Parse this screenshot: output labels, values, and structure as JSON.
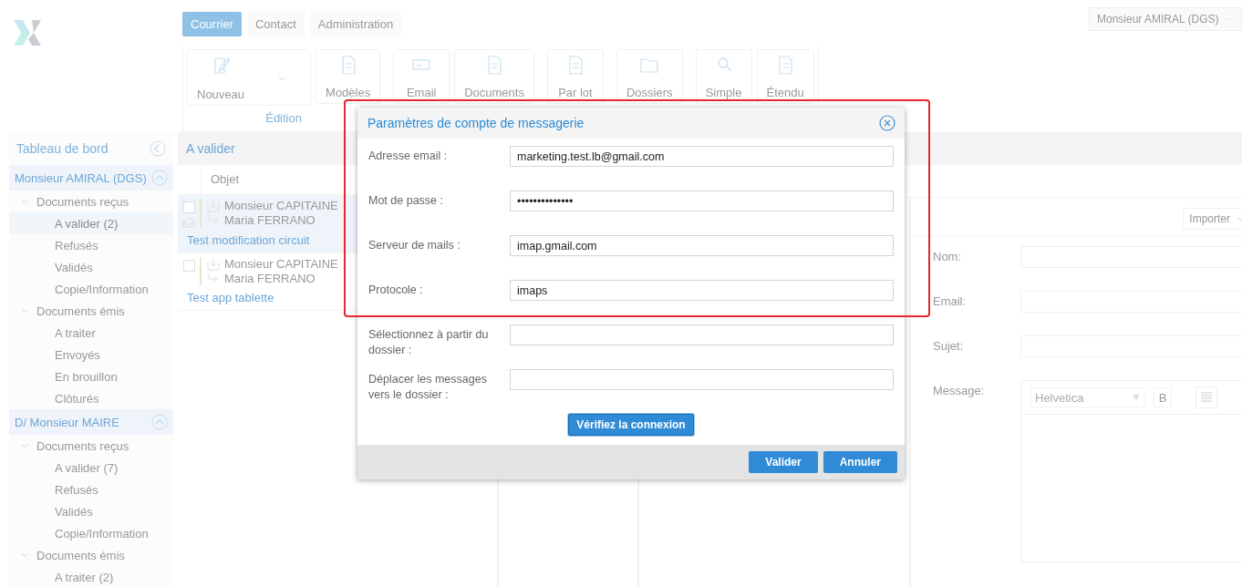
{
  "top_bar": {
    "tabs": [
      {
        "label": "Courrier",
        "selected": true
      },
      {
        "label": "Contact",
        "selected": false
      },
      {
        "label": "Administration",
        "selected": false
      }
    ],
    "user_select": "Monsieur AMIRAL (DGS)"
  },
  "ribbon": {
    "groups": [
      {
        "label": "Édition",
        "buttons": [
          {
            "label": "Nouveau",
            "kind": "split"
          },
          {
            "label": "Modèles",
            "kind": "plain"
          }
        ]
      },
      {
        "buttons": [
          {
            "label": "Email",
            "kind": "plain"
          },
          {
            "label": "Documents",
            "kind": "plain"
          }
        ]
      },
      {
        "buttons": [
          {
            "label": "Par lot",
            "kind": "plain"
          }
        ]
      },
      {
        "buttons": [
          {
            "label": "Dossiers",
            "kind": "plain"
          }
        ]
      },
      {
        "buttons": [
          {
            "label": "Simple",
            "kind": "plain"
          },
          {
            "label": "Étendu",
            "kind": "plain"
          }
        ]
      }
    ]
  },
  "sidebar": {
    "title": "Tableau de bord",
    "sections": [
      {
        "label": "Monsieur AMIRAL (DGS)",
        "expanded": true,
        "children": [
          {
            "label": "Documents reçus",
            "expanded": true,
            "children": [
              {
                "label": "A valider (2)",
                "selected": true
              },
              {
                "label": "Refusés",
                "selected": false
              },
              {
                "label": "Validés",
                "selected": false
              },
              {
                "label": "Copie/Information",
                "selected": false
              }
            ]
          },
          {
            "label": "Documents émis",
            "expanded": true,
            "children": [
              {
                "label": "A traiter",
                "selected": false
              },
              {
                "label": "Envoyés",
                "selected": false
              },
              {
                "label": "En brouillon",
                "selected": false
              },
              {
                "label": "Clôturés",
                "selected": false
              }
            ]
          }
        ]
      },
      {
        "label": "D/ Monsieur MAIRE",
        "expanded": true,
        "children": [
          {
            "label": "Documents reçus",
            "expanded": true,
            "children": [
              {
                "label": "A valider (7)",
                "selected": false
              },
              {
                "label": "Refusés",
                "selected": false
              },
              {
                "label": "Validés",
                "selected": false
              },
              {
                "label": "Copie/Information",
                "selected": false
              }
            ]
          },
          {
            "label": "Documents émis",
            "expanded": true,
            "children": [
              {
                "label": "A traiter (2)",
                "selected": false
              }
            ]
          }
        ]
      }
    ]
  },
  "list": {
    "title": "A valider",
    "column": "Objet",
    "rows": [
      {
        "checked": false,
        "opened": true,
        "from": "Monsieur CAPITAINE",
        "to": "Maria FERRANO",
        "subject": "Test modification circuit",
        "selected": true
      },
      {
        "checked": false,
        "opened": false,
        "from": "Monsieur CAPITAINE",
        "to": "Maria FERRANO",
        "subject": "Test app tablette",
        "selected": false
      }
    ]
  },
  "compose": {
    "import_button": "Importer",
    "fields": [
      {
        "label": "Nom:",
        "kind": "line"
      },
      {
        "label": "Email:",
        "kind": "line"
      },
      {
        "label": "Sujet:",
        "kind": "line"
      },
      {
        "label": "Message:",
        "kind": "editor"
      }
    ],
    "editor": {
      "font": "Helvetica",
      "bold_button": "B"
    }
  },
  "dialog": {
    "title": "Paramètres de compte de messagerie",
    "fields": [
      {
        "label": "Adresse email :",
        "value": "marketing.test.lb@gmail.com"
      },
      {
        "label": "Mot de passe :",
        "value": "••••••••••••••"
      },
      {
        "label": "Serveur de mails :",
        "value": "imap.gmail.com"
      },
      {
        "label": "Protocole :",
        "value": "imaps"
      },
      {
        "label": "Sélectionnez à partir du dossier :"
      },
      {
        "label": "Déplacer les messages vers le dossier :"
      }
    ],
    "check_button": "Vérifiez la connexion",
    "buttons": [
      "Valider",
      "Annuler"
    ]
  }
}
